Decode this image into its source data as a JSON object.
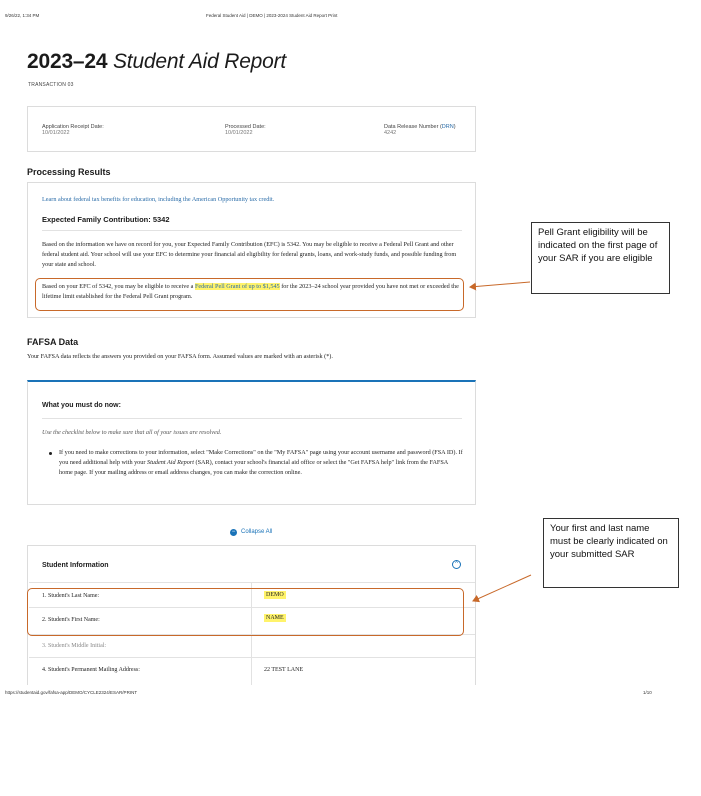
{
  "print_header": {
    "datetime": "9/26/22, 1:34 PM",
    "center": "Federal Student Aid | DEMO | 2023-2024 Student Aid Report Print"
  },
  "print_footer": {
    "url": "https://studentaid.gov/fafsa-app/DEMO/CYCLE2324/ESAR/PRINT",
    "page": "1/10"
  },
  "report": {
    "title_year": "2023–24",
    "title_text": "Student Aid Report",
    "transaction": "TRANSACTION 03"
  },
  "meta": {
    "receipt_label": "Application Receipt Date:",
    "receipt_value": "10/01/2022",
    "processed_label": "Processed Date:",
    "processed_value": "10/01/2022",
    "drn_label_prefix": "Data Release Number (",
    "drn_label_link": "DRN",
    "drn_label_suffix": ")",
    "drn_value": "4242"
  },
  "processing": {
    "heading": "Processing Results",
    "tax_link": "Learn about federal tax benefits for education, including the American Opportunity tax credit.",
    "efc_heading": "Expected Family Contribution: 5342",
    "efc_para": "Based on the information we have on record for you, your Expected Family Contribution (EFC) is 5342. You may be eligible to receive a Federal Pell Grant and other federal student aid. Your school will use your EFC to determine your financial aid eligibility for federal grants, loans, and work-study funds, and possible funding from your state and school.",
    "pell_before": "Based on your EFC of 5342, you may be eligible to receive a ",
    "pell_link": "Federal Pell Grant of up to $1,545",
    "pell_after": " for the 2023–24 school year provided you have not met or exceeded the lifetime limit established for the Federal Pell Grant program."
  },
  "fafsa": {
    "heading": "FAFSA Data",
    "intro": "Your FAFSA data reflects the answers you provided on your FAFSA form. Assumed values are marked with an asterisk (*).",
    "must_do_heading": "What you must do now:",
    "checklist_note": "Use the checklist below to make sure that all of your issues are resolved.",
    "bullet_1": "If you need to make corrections to your information, select \"Make Corrections\" on the \"My FAFSA\" page using your account username and password (FSA ID). If you need additional help with your ",
    "bullet_italic": "Student Aid Report",
    "bullet_2": " (SAR), contact your school's financial aid office or select the \"Get FAFSA help\" link from the FAFSA home page. If your mailing address or email address changes, you can make the correction online.",
    "collapse_all": "Collapse All"
  },
  "student_info": {
    "heading": "Student Information",
    "rows": [
      {
        "label": "1. Student's Last Name:",
        "value": "DEMO"
      },
      {
        "label": "2. Student's First Name:",
        "value": "NAME"
      },
      {
        "label": "3. Student's Middle Initial:",
        "value": ""
      },
      {
        "label": "4. Student's Permanent Mailing Address:",
        "value": "22 TEST LANE"
      }
    ]
  },
  "callouts": {
    "pell": "Pell Grant eligibility will be indicated on the first page of your SAR if you are eligible",
    "name": "Your first and last name must be clearly indicated on your submitted SAR"
  },
  "colors": {
    "annotation_orange": "#c8692a",
    "highlight_yellow": "#fff36b",
    "link_blue": "#2a6ca8",
    "accent_blue": "#1a73b8"
  }
}
